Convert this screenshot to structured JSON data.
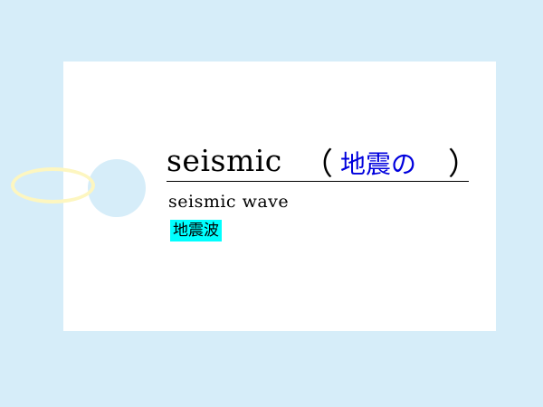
{
  "card": {
    "headword": "seismic",
    "paren_open": "（",
    "meaning": "地震の",
    "paren_close": "）",
    "example": "seismic wave",
    "translation": "地震波"
  },
  "colors": {
    "background": "#d6edf9",
    "card": "#ffffff",
    "meaning": "#0000dd",
    "highlight": "#00ffff",
    "string": "#fdf6c0"
  }
}
